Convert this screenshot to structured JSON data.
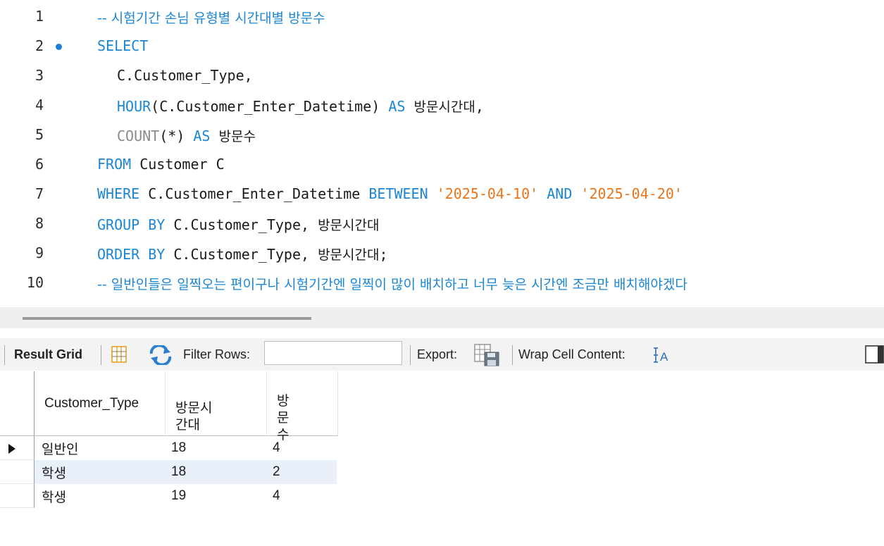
{
  "editor": {
    "lines": [
      {
        "n": "1",
        "comment": "-- 시험기간 손님 유형별 시간대별 방문수"
      },
      {
        "n": "2",
        "select": "SELECT"
      },
      {
        "n": "3",
        "text": "C.Customer_Type,"
      },
      {
        "n": "4",
        "fn": "HOUR",
        "arg": "(C.Customer_Enter_Datetime)",
        "as": "AS",
        "alias": "방문시간대",
        "tail": ","
      },
      {
        "n": "5",
        "fn": "COUNT",
        "arg": "(*)",
        "as": "AS",
        "alias": "방문수"
      },
      {
        "n": "6",
        "from": "FROM",
        "text": "Customer C"
      },
      {
        "n": "7",
        "where": "WHERE",
        "col": "C.Customer_Enter_Datetime",
        "between": "BETWEEN",
        "s1": "'2025-04-10'",
        "and": "AND",
        "s2": "'2025-04-20'"
      },
      {
        "n": "8",
        "kw": "GROUP BY",
        "col": "C.Customer_Type,",
        "alias": "방문시간대"
      },
      {
        "n": "9",
        "kw": "ORDER BY",
        "col": "C.Customer_Type,",
        "alias": "방문시간대",
        "tail": ";"
      },
      {
        "n": "10",
        "comment": "-- 일반인들은 일찍오는 편이구나 시험기간엔 일찍이 많이 배치하고 너무 늦은 시간엔 조금만 배치해야겠다"
      }
    ]
  },
  "toolbar": {
    "result_grid_label": "Result Grid",
    "filter_label": "Filter Rows:",
    "filter_value": "",
    "export_label": "Export:",
    "wrap_label": "Wrap Cell Content:"
  },
  "grid": {
    "columns": [
      "Customer_Type",
      "방문시\n간대",
      "방\n문\n수"
    ],
    "rows": [
      [
        "일반인",
        "18",
        "4"
      ],
      [
        "학생",
        "18",
        "2"
      ],
      [
        "학생",
        "19",
        "4"
      ]
    ]
  },
  "colors": {
    "keyword": "#1b86d3",
    "string": "#e8751a",
    "breakpoint": "#1f7fd6"
  }
}
